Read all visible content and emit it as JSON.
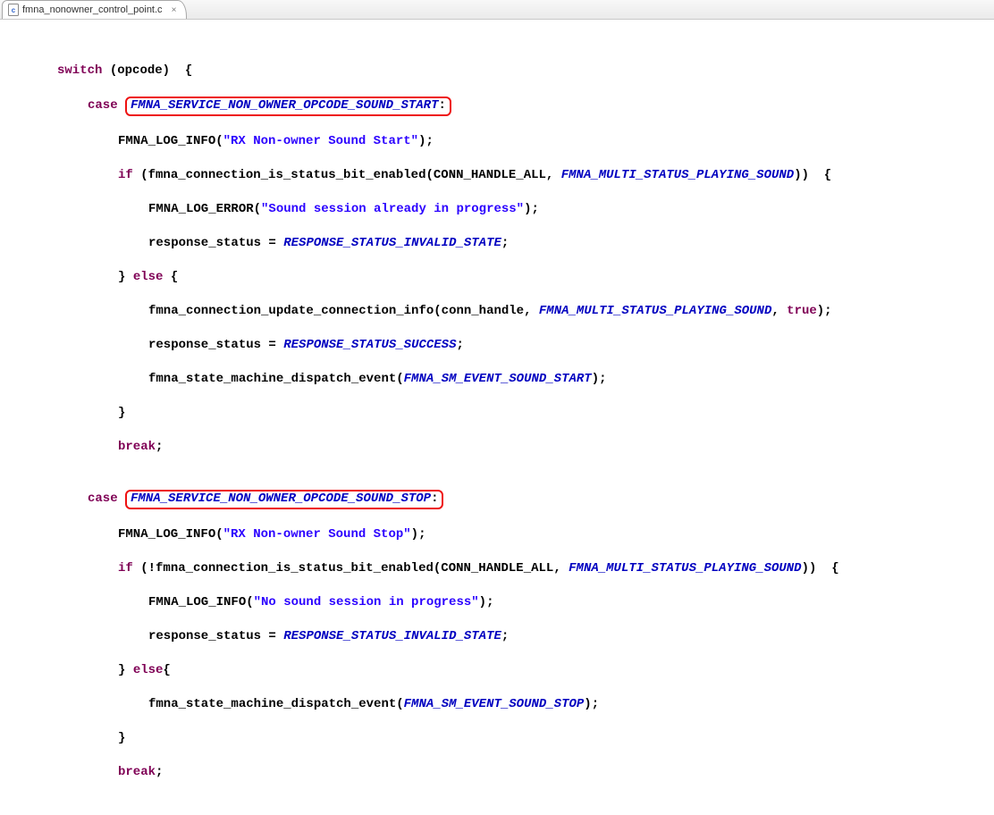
{
  "tab": {
    "filename": "fmna_nonowner_control_point.c",
    "close_glyph": "×"
  },
  "kw": {
    "switch": "switch",
    "case": "case",
    "if": "if",
    "else": "else",
    "break": "break",
    "true": "true"
  },
  "code": {
    "switch_var": "opcode",
    "case1": "FMNA_SERVICE_NON_OWNER_OPCODE_SOUND_START",
    "log_info_fn": "FMNA_LOG_INFO",
    "log_error_fn": "FMNA_LOG_ERROR",
    "str_rx_start": "\"RX Non-owner Sound Start\"",
    "if_cond_fn": "fmna_connection_is_status_bit_enabled",
    "conn_handle_all": "CONN_HANDLE_ALL",
    "multi_status_playing": "FMNA_MULTI_STATUS_PLAYING_SOUND",
    "str_sess_in_progress": "\"Sound session already in progress\"",
    "response_status_var": "response_status",
    "resp_invalid": "RESPONSE_STATUS_INVALID_STATE",
    "update_conn_fn": "fmna_connection_update_connection_info",
    "conn_handle_var": "conn_handle",
    "resp_success": "RESPONSE_STATUS_SUCCESS",
    "dispatch_fn": "fmna_state_machine_dispatch_event",
    "sm_event_start": "FMNA_SM_EVENT_SOUND_START",
    "case2": "FMNA_SERVICE_NON_OWNER_OPCODE_SOUND_STOP",
    "str_rx_stop": "\"RX Non-owner Sound Stop\"",
    "str_no_sess": "\"No sound session in progress\"",
    "sm_event_stop": "FMNA_SM_EVENT_SOUND_STOP"
  }
}
